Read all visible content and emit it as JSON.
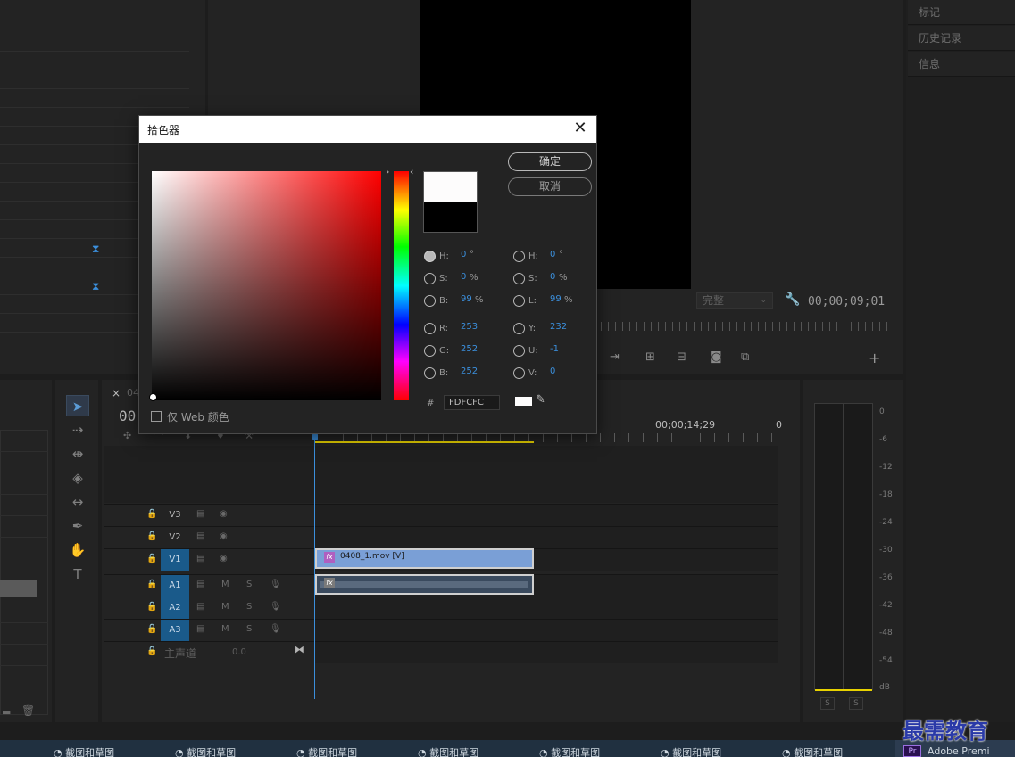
{
  "side_panel": {
    "tabs": [
      "标记",
      "历史记录",
      "信息"
    ]
  },
  "program_monitor": {
    "fit_select": "完整",
    "timecode": "00;00;09;01",
    "add_icon": "plus-icon"
  },
  "timeline": {
    "close_glyph": "×",
    "sequence_name_partial": "04",
    "timecode_partial": "00;",
    "ruler_time": "00;00;14;29",
    "ruler_edge_partial": "0",
    "tracks": [
      {
        "name": "V3",
        "type": "video",
        "active": false
      },
      {
        "name": "V2",
        "type": "video",
        "active": false
      },
      {
        "name": "V1",
        "type": "video",
        "active": true
      },
      {
        "name": "A1",
        "type": "audio",
        "active": true
      },
      {
        "name": "A2",
        "type": "audio",
        "active": true
      },
      {
        "name": "A3",
        "type": "audio",
        "active": true
      }
    ],
    "mute_label": "M",
    "solo_label": "S",
    "master_label": "主声道",
    "master_value": "0.0",
    "clip_label": "0408_1.mov [V]",
    "fx_label": "fx"
  },
  "audio_meter": {
    "scale": [
      "0",
      "-6",
      "-12",
      "-18",
      "-24",
      "-30",
      "-36",
      "-42",
      "-48",
      "-54",
      "dB"
    ],
    "solo_buttons": [
      "S",
      "S"
    ]
  },
  "color_picker": {
    "title": "拾色器",
    "ok_label": "确定",
    "cancel_label": "取消",
    "hsb": {
      "h_label": "H:",
      "h_value": "0",
      "h_unit": "°",
      "s_label": "S:",
      "s_value": "0",
      "s_unit": "%",
      "b_label": "B:",
      "b_value": "99",
      "b_unit": "%"
    },
    "hsl": {
      "h_label": "H:",
      "h_value": "0",
      "h_unit": "°",
      "s_label": "S:",
      "s_value": "0",
      "s_unit": "%",
      "l_label": "L:",
      "l_value": "99",
      "l_unit": "%"
    },
    "rgb": {
      "r_label": "R:",
      "r_value": "253",
      "g_label": "G:",
      "g_value": "252",
      "b_label": "B:",
      "b_value": "252"
    },
    "yuv": {
      "y_label": "Y:",
      "y_value": "232",
      "u_label": "U:",
      "u_value": "-1",
      "v_label": "V:",
      "v_value": "0"
    },
    "hash_label": "#",
    "hex_value": "FDFCFC",
    "web_only_label": "仅 Web 颜色",
    "new_color": "#fdfcfc",
    "old_color": "#000000",
    "selected_hue_color": "#ff0000"
  },
  "taskbar": {
    "item_label": "截图和草图",
    "item_count": 7,
    "app_label_partial": "Adobe Premi",
    "app_icon_text": "Pr"
  },
  "watermark": {
    "text": "最需教育"
  },
  "colors": {
    "accent_blue": "#3b8fdc",
    "track_active": "#1a5a8a",
    "clip_blue": "#7a9fd6",
    "playhead": "#3b8fdc"
  }
}
